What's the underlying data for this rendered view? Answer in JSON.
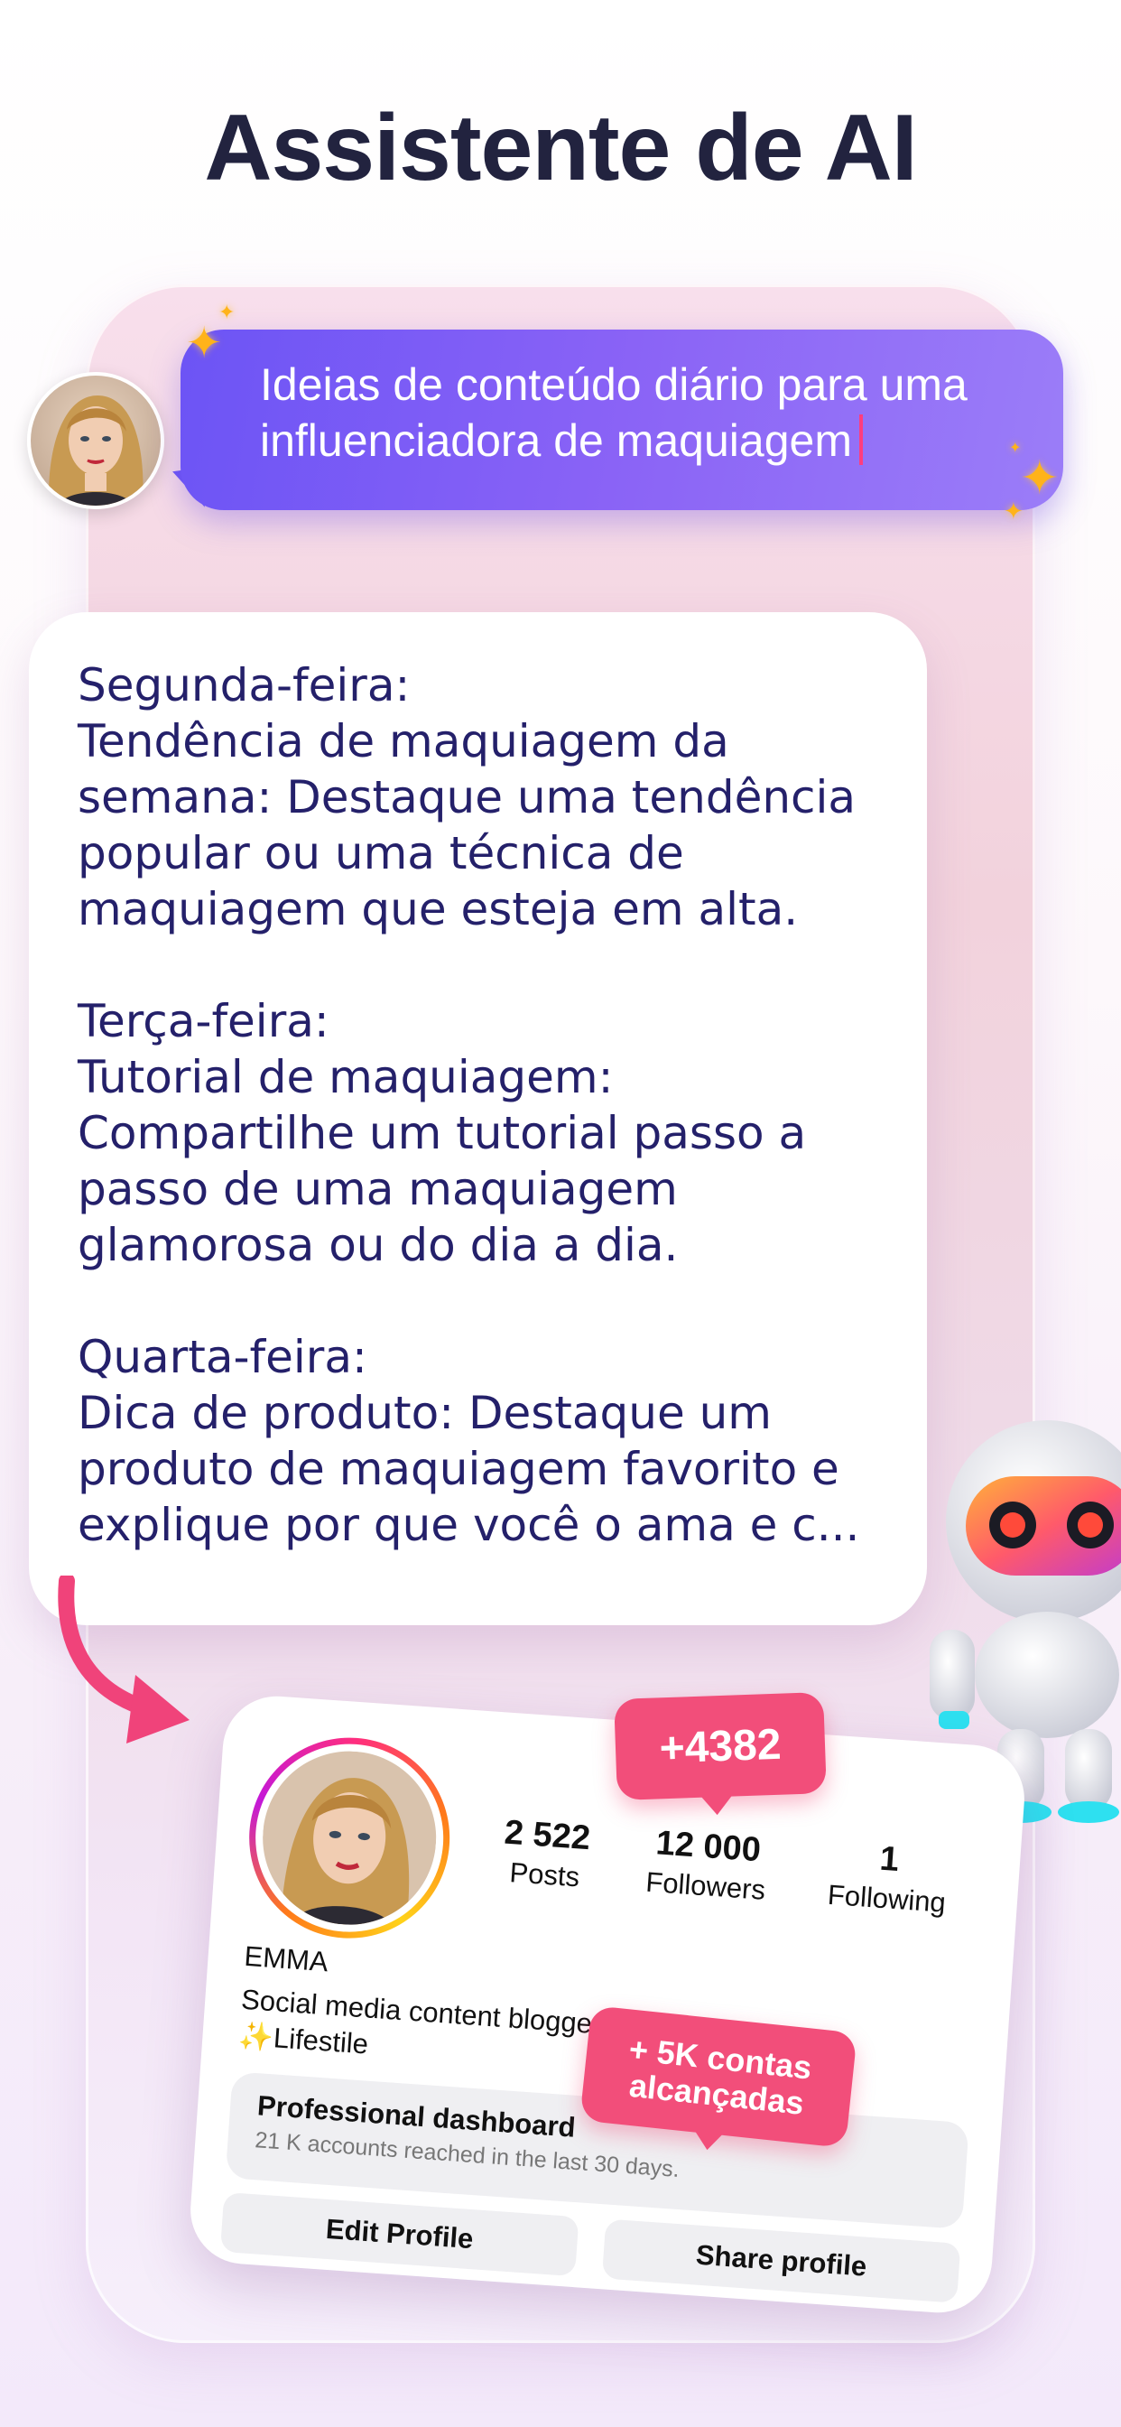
{
  "headline": "Assistente de AI",
  "prompt": {
    "line1": "Ideias de conteúdo diário para uma",
    "line2": "influenciadora de maquiagem"
  },
  "answer": {
    "monday_title": "Segunda-feira:",
    "monday_body": "Tendência de maquiagem da\nsemana: Destaque uma tendência\npopular ou uma técnica de\nmaquiagem que esteja em alta.",
    "tuesday_title": "Terça-feira:",
    "tuesday_body": "Tutorial de maquiagem:\nCompartilhe um tutorial passo a\npasso de uma maquiagem\nglamorosa ou do dia a dia.",
    "wednesday_title": "Quarta-feira:",
    "wednesday_body": "Dica de produto: Destaque um\nproduto de maquiagem favorito e\nexplique por que você o ama e c..."
  },
  "profile": {
    "name": "EMMA",
    "bio_line1": "Social media content blogger",
    "bio_line2": "✨Lifestile",
    "stats": [
      {
        "value": "2 522",
        "label": "Posts"
      },
      {
        "value": "12 000",
        "label": "Followers"
      },
      {
        "value": "1",
        "label": "Following"
      }
    ],
    "dashboard_title": "Professional dashboard",
    "dashboard_sub": "21 K accounts reached in the last 30 days.",
    "edit_button": "Edit Profile",
    "share_button": "Share profile"
  },
  "badges": {
    "followers": "+4382",
    "reach_line1": "+ 5K contas",
    "reach_line2": "alcançadas"
  },
  "colors": {
    "headline": "#22233f",
    "prompt_bubble": "#7b5cf6",
    "answer_text": "#24206a",
    "badge": "#f24e7a",
    "sparkle": "#ffb31a"
  }
}
